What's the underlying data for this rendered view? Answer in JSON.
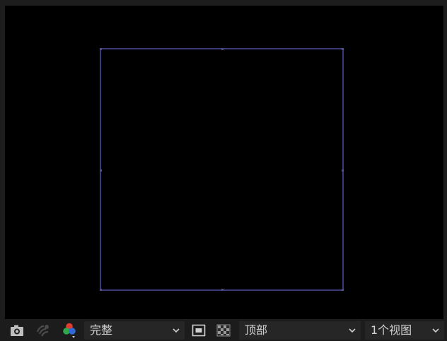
{
  "viewport": {
    "background": "#000000",
    "comp_border_color": "#3a3a78"
  },
  "toolbar": {
    "snapshot_icon": "camera-icon",
    "show_snapshot_icon": "show-snapshot-icon",
    "channels_icon": "rgb-channels-icon",
    "resolution_label": "完整",
    "toggle_mask_icon": "toggle-mask-icon",
    "transparency_grid_icon": "transparency-grid-icon",
    "view_label": "顶部",
    "layout_label": "1个视图"
  }
}
